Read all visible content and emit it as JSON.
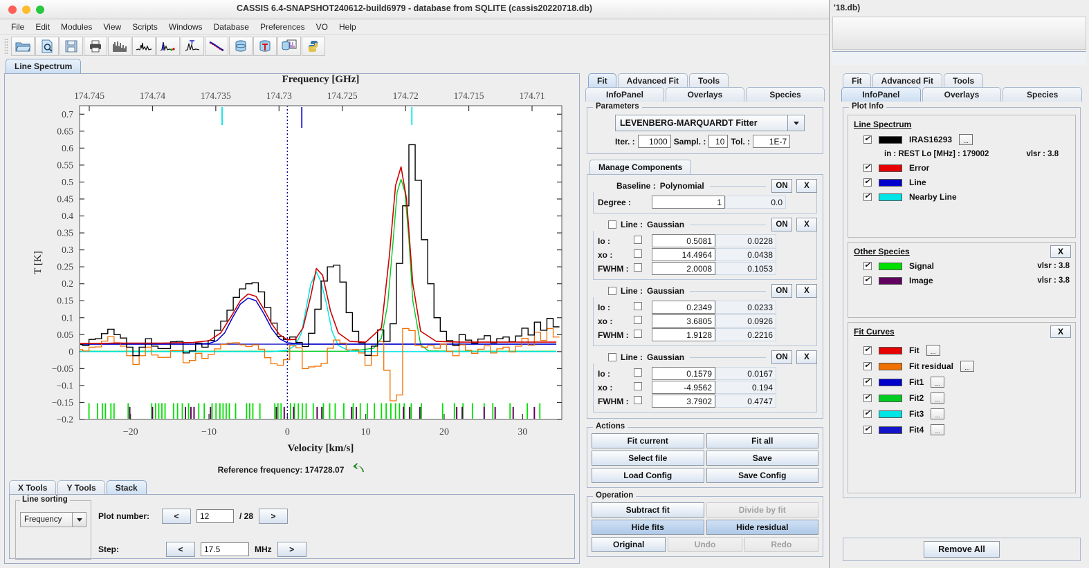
{
  "window": {
    "title": "CASSIS 6.4-SNAPSHOT240612-build6979 - database from SQLITE (cassis20220718.db)",
    "background_window_title": "'18.db)"
  },
  "menu": {
    "items": [
      "File",
      "Edit",
      "Modules",
      "View",
      "Scripts",
      "Windows",
      "Database",
      "Preferences",
      "VO",
      "Help"
    ]
  },
  "toolbar": {
    "icons": [
      "open-folder-icon",
      "document-search-icon",
      "save-disk-icon",
      "print-icon",
      "line-list-icon",
      "spectrum-noise-icon",
      "spectrum-markers-icon",
      "spectrum-tag-icon",
      "continuum-fit-icon",
      "database-icon",
      "database-temperature-icon",
      "database-spectrum-icon",
      "python-script-icon"
    ]
  },
  "main_tabs": {
    "items": [
      "Line Spectrum"
    ],
    "selected": "Line Spectrum"
  },
  "chart_data": {
    "type": "line",
    "title": "",
    "xlabel": "Velocity [km/s]",
    "ylabel": "T [K]",
    "top_axis_label": "Frequency [GHz]",
    "top_axis_ticks": [
      "174.745",
      "174.74",
      "174.735",
      "174.73",
      "174.725",
      "174.72",
      "174.715",
      "174.71"
    ],
    "top_axis_values": [
      174.745,
      174.74,
      174.735,
      174.73,
      174.725,
      174.72,
      174.715,
      174.71
    ],
    "xticks": [
      -20,
      -10,
      0,
      10,
      20,
      30
    ],
    "xlim": [
      -26.5,
      35.0
    ],
    "yticks": [
      0.7,
      0.65,
      0.6,
      0.55,
      0.5,
      0.45,
      0.4,
      0.35,
      0.3,
      0.25,
      0.2,
      0.15,
      0.1,
      0.05,
      0,
      -0.05,
      -0.1,
      -0.15,
      -0.2
    ],
    "ylim": [
      -0.2,
      0.725
    ],
    "grid": false,
    "reference_frequency_label": "Reference frequency: 174728.07",
    "series": [
      {
        "name": "IRAS16293",
        "color": "#000000",
        "comment": "observed spectrum, histogram step",
        "x": [
          -26.5,
          -25.7,
          -24.9,
          -24.1,
          -23.3,
          -22.5,
          -21.7,
          -20.9,
          -20.1,
          -19.3,
          -18.5,
          -17.7,
          -16.9,
          -16.1,
          -15.3,
          -14.5,
          -13.7,
          -12.9,
          -12.1,
          -11.3,
          -10.5,
          -9.7,
          -8.9,
          -8.1,
          -7.3,
          -6.5,
          -5.7,
          -4.9,
          -4.1,
          -3.3,
          -2.5,
          -1.7,
          -0.9,
          -0.1,
          0.7,
          1.5,
          2.3,
          3.1,
          3.9,
          4.7,
          5.5,
          6.3,
          7.1,
          7.9,
          8.7,
          9.5,
          10.3,
          11.1,
          11.9,
          12.7,
          13.5,
          14.3,
          15.1,
          15.9,
          16.7,
          17.5,
          18.3,
          19.1,
          19.9,
          20.7,
          21.5,
          22.3,
          23.1,
          23.9,
          24.7,
          25.5,
          26.3,
          27.1,
          27.9,
          28.7,
          29.5,
          30.3,
          31.1,
          31.9,
          32.7,
          33.5,
          34.3
        ],
        "y": [
          0.021,
          0.018,
          0.036,
          0.038,
          0.053,
          0.066,
          0.05,
          0.04,
          0.013,
          -0.012,
          0.013,
          0.038,
          0.016,
          0.009,
          0.009,
          0.029,
          0.03,
          -0.004,
          0.002,
          0.025,
          0.013,
          0.033,
          0.063,
          0.09,
          0.122,
          0.16,
          0.185,
          0.2,
          0.203,
          0.176,
          0.13,
          0.084,
          0.045,
          0.036,
          0.043,
          0.027,
          0.015,
          0.054,
          0.125,
          0.208,
          0.25,
          0.255,
          0.205,
          0.115,
          0.06,
          0.026,
          -0.011,
          0.016,
          0.064,
          0.03,
          0.082,
          0.26,
          0.43,
          0.61,
          0.505,
          0.33,
          0.2,
          0.1,
          0.06,
          0.032,
          0.018,
          0.05,
          0.034,
          0.025,
          0.037,
          0.047,
          0.026,
          0.038,
          0.043,
          0.029,
          0.046,
          0.069,
          0.049,
          0.087,
          0.063,
          0.098,
          0.073
        ]
      },
      {
        "name": "Fit",
        "color": "#d00000",
        "comment": "total fit curve (red)",
        "x": [
          -26.5,
          -24,
          -22,
          -20,
          -18,
          -16,
          -14,
          -12,
          -10,
          -8.5,
          -7,
          -6,
          -5,
          -4,
          -3,
          -2,
          -1,
          0,
          1,
          2,
          3,
          3.7,
          4.5,
          5.5,
          6.5,
          8,
          10,
          12,
          13,
          13.8,
          14.5,
          15.2,
          16,
          17,
          19,
          22,
          26,
          30,
          34.3
        ],
        "y": [
          0.024,
          0.024,
          0.025,
          0.025,
          0.025,
          0.025,
          0.026,
          0.027,
          0.032,
          0.055,
          0.11,
          0.15,
          0.17,
          0.163,
          0.125,
          0.082,
          0.05,
          0.035,
          0.036,
          0.07,
          0.165,
          0.245,
          0.225,
          0.12,
          0.055,
          0.03,
          0.028,
          0.07,
          0.28,
          0.49,
          0.545,
          0.45,
          0.2,
          0.06,
          0.03,
          0.028,
          0.028,
          0.028,
          0.028
        ]
      },
      {
        "name": "Fit residual",
        "color": "#f07000",
        "comment": "residual (orange, noisy around zero)",
        "x": [
          -26.5,
          -25.7,
          -24.9,
          -24.1,
          -23.3,
          -22.5,
          -21.7,
          -20.9,
          -20.1,
          -19.3,
          -18.5,
          -17.7,
          -16.9,
          -16.1,
          -15.3,
          -14.5,
          -13.7,
          -12.9,
          -12.1,
          -11.3,
          -10.5,
          -9.7,
          -8.9,
          -8.1,
          -7.3,
          -6.5,
          -5.7,
          -4.9,
          -4.1,
          -3.3,
          -2.5,
          -1.7,
          -0.9,
          -0.1,
          0.7,
          1.5,
          2.3,
          3.1,
          3.9,
          4.7,
          5.5,
          6.3,
          7.1,
          7.9,
          8.7,
          9.5,
          10.3,
          11.1,
          11.9,
          12.7,
          13.5,
          14.3,
          15.1,
          15.9,
          16.7,
          17.5,
          18.3,
          19.1,
          19.9,
          20.7,
          21.5,
          22.3,
          23.1,
          23.9,
          24.7,
          25.5,
          26.3,
          27.1,
          27.9,
          28.7,
          29.5,
          30.3,
          31.1,
          31.9,
          32.7,
          33.5,
          34.3
        ],
        "y": [
          0.006,
          0.002,
          0.013,
          0.014,
          0.031,
          0.044,
          0.026,
          0.016,
          -0.012,
          -0.038,
          -0.012,
          0.013,
          -0.01,
          -0.017,
          -0.017,
          0.003,
          0.003,
          -0.033,
          -0.026,
          -0.005,
          -0.02,
          -0.008,
          0.008,
          0.021,
          0.025,
          0.026,
          0.02,
          0.015,
          0.02,
          0.007,
          -0.018,
          -0.036,
          -0.04,
          -0.024,
          0.018,
          0.011,
          -0.05,
          -0.045,
          -0.043,
          -0.035,
          0.01,
          0.034,
          0.025,
          0.005,
          0.006,
          -0.004,
          -0.04,
          -0.012,
          0.03,
          -0.055,
          -0.145,
          -0.128,
          0.068,
          0.062,
          0.018,
          0.013,
          0.018,
          0.01,
          0.022,
          0.001,
          -0.012,
          0.02,
          0.004,
          -0.005,
          0.007,
          0.017,
          -0.004,
          0.008,
          0.013,
          -0.001,
          0.016,
          0.039,
          0.019,
          0.057,
          0.033,
          0.068,
          0.043
        ]
      },
      {
        "name": "Fit1",
        "color": "#0000cd",
        "comment": "Gaussian component 1 (blue) centered near -4.96",
        "x": [
          -26.5,
          -16,
          -12,
          -10,
          -9,
          -8,
          -7,
          -6,
          -5,
          -4,
          -3,
          -2,
          -1,
          0,
          2,
          6,
          12,
          20,
          30,
          34.3
        ],
        "y": [
          0.022,
          0.022,
          0.022,
          0.024,
          0.032,
          0.055,
          0.1,
          0.14,
          0.158,
          0.15,
          0.112,
          0.068,
          0.038,
          0.026,
          0.022,
          0.022,
          0.022,
          0.022,
          0.022,
          0.022
        ]
      },
      {
        "name": "Fit2",
        "color": "#00cc22",
        "comment": "Gaussian component 2 (green) near 14.5",
        "x": [
          -26.5,
          0,
          8,
          11,
          12,
          12.8,
          13.5,
          14,
          14.5,
          15,
          15.5,
          16,
          17,
          18,
          22,
          30,
          34.3
        ],
        "y": [
          0.001,
          0.001,
          0.001,
          0.01,
          0.04,
          0.14,
          0.33,
          0.47,
          0.508,
          0.47,
          0.33,
          0.15,
          0.02,
          0.002,
          0.001,
          0.001,
          0.001
        ]
      },
      {
        "name": "Fit3",
        "color": "#00e5e5",
        "comment": "Gaussian component 3 (cyan) near 3.68",
        "x": [
          -26.5,
          -2,
          0,
          1,
          1.8,
          2.5,
          3.0,
          3.7,
          4.3,
          5,
          5.7,
          6.5,
          8,
          12,
          20,
          34.3
        ],
        "y": [
          0.0,
          0.0,
          0.004,
          0.018,
          0.055,
          0.14,
          0.2,
          0.235,
          0.205,
          0.14,
          0.06,
          0.018,
          0.001,
          0.0,
          0.0,
          0.0
        ]
      },
      {
        "name": "Fit4",
        "color": "#1414c8",
        "comment": "baseline polynomial degree 1 (blue flat)",
        "x": [
          -26.5,
          34.3
        ],
        "y": [
          0.022,
          0.022
        ]
      },
      {
        "name": "Signal",
        "color": "#00cc22",
        "comment": "signal species marker ticks at y=-0.15..-0.2",
        "velocities": [
          -25.3,
          -24.2,
          -23.6,
          -23.2,
          -22.5,
          -22.1,
          -20.3,
          -17.3,
          -16.8,
          -16.4,
          -16.0,
          -15.6,
          -14.5,
          -14.0,
          -13.4,
          -12.6,
          -11.3,
          -10.6,
          -9.6,
          -9.1,
          -8.6,
          -8.2,
          -7.8,
          -7.4,
          -6.6,
          -5.2,
          -4.8,
          -4.4,
          -3.5,
          -1.6,
          -1.2,
          -0.8,
          0.4,
          0.9,
          1.4,
          1.9,
          2.4,
          3.3,
          4.6,
          5.4,
          6.1,
          7.2,
          8.4,
          9.3,
          10.2,
          11.1,
          12.0,
          12.6,
          13.2,
          13.8,
          14.3,
          14.9,
          15.8,
          17.1,
          19.8,
          21.3,
          22.4,
          23.6,
          25.1,
          26.2,
          28.4,
          30.6,
          32.2
        ]
      },
      {
        "name": "Image",
        "color": "#60005f",
        "comment": "image species marker ticks (dark purple)",
        "velocities": [
          -20.1,
          -17.2,
          -13.0,
          -12.3,
          -11.9,
          -9.8,
          -1.4,
          -0.4,
          0.8,
          3.8,
          4.4,
          8.2,
          8.8,
          14.8,
          15.6,
          16.9,
          21.6,
          22.3,
          25.1,
          26.5,
          28.8,
          31.5
        ]
      },
      {
        "name": "Nearby Line",
        "color": "#00e5e5",
        "comment": "nearby line markers at top of plot",
        "frequencies": [
          174.7345,
          174.7195
        ]
      },
      {
        "name": "Line",
        "color": "#0000cd",
        "comment": "line marker at top of plot",
        "frequencies": [
          174.7282
        ]
      }
    ],
    "vertical_reference": {
      "velocity": 0,
      "color": "#00008b",
      "style": "dotted"
    }
  },
  "bottom_tabs": {
    "items": [
      "X Tools",
      "Y Tools",
      "Stack"
    ],
    "selected": "Stack"
  },
  "stack": {
    "line_sorting_label": "Line sorting",
    "sort_by": "Frequency",
    "plot_number_label": "Plot number:",
    "plot_number": "12",
    "plot_total": "/ 28",
    "step_label": "Step:",
    "step_value": "17.5",
    "step_unit": "MHz",
    "prev_label": "<",
    "next_label": ">"
  },
  "fit_panel": {
    "tabs_row1": [
      "Fit",
      "Advanced Fit",
      "Tools"
    ],
    "tabs_row1_selected": "Fit",
    "tabs_row2": [
      "InfoPanel",
      "Overlays",
      "Species"
    ],
    "tabs_row2_selected": "",
    "parameters": {
      "group_label": "Parameters",
      "fitter": "LEVENBERG-MARQUARDT Fitter",
      "iter_label": "Iter. :",
      "iter_value": "1000",
      "sampl_label": "Sampl. :",
      "sampl_value": "10",
      "tol_label": "Tol. :",
      "tol_value": "1E-7"
    },
    "manage_components_label": "Manage Components",
    "baseline": {
      "label": "Baseline :",
      "type": "Polynomial",
      "on_label": "ON",
      "x_label": "X",
      "degree_label": "Degree :",
      "degree_value": "1",
      "degree_err": "0.0"
    },
    "components": [
      {
        "label": "Line :",
        "type": "Gaussian",
        "on_label": "ON",
        "x_label": "X",
        "rows": [
          {
            "name": "Io :",
            "value": "0.5081",
            "error": "0.0228"
          },
          {
            "name": "xo :",
            "value": "14.4964",
            "error": "0.0438"
          },
          {
            "name": "FWHM :",
            "value": "2.0008",
            "error": "0.1053"
          }
        ]
      },
      {
        "label": "Line :",
        "type": "Gaussian",
        "on_label": "ON",
        "x_label": "X",
        "rows": [
          {
            "name": "Io :",
            "value": "0.2349",
            "error": "0.0233"
          },
          {
            "name": "xo :",
            "value": "3.6805",
            "error": "0.0926"
          },
          {
            "name": "FWHM :",
            "value": "1.9128",
            "error": "0.2216"
          }
        ]
      },
      {
        "label": "Line :",
        "type": "Gaussian",
        "on_label": "ON",
        "x_label": "X",
        "rows": [
          {
            "name": "Io :",
            "value": "0.1579",
            "error": "0.0167"
          },
          {
            "name": "xo :",
            "value": "-4.9562",
            "error": "0.194"
          },
          {
            "name": "FWHM :",
            "value": "3.7902",
            "error": "0.4747"
          }
        ]
      }
    ],
    "actions": {
      "group_label": "Actions",
      "buttons": [
        "Fit current",
        "Fit all",
        "Select file",
        "Save",
        "Load Config",
        "Save Config"
      ]
    },
    "operation": {
      "group_label": "Operation",
      "subtract_fit": "Subtract fit",
      "divide_by_fit": "Divide by fit",
      "hide_fits": "Hide fits",
      "hide_residual": "Hide residual",
      "original": "Original",
      "undo": "Undo",
      "redo": "Redo"
    }
  },
  "info_panel": {
    "tabs_row1": [
      "Fit",
      "Advanced Fit",
      "Tools"
    ],
    "tabs_row2": [
      "InfoPanel",
      "Overlays",
      "Species"
    ],
    "tabs_row2_selected": "InfoPanel",
    "plot_info_label": "Plot Info",
    "line_spectrum_header": "Line Spectrum",
    "spectrum_entries": [
      {
        "label": "IRAS16293",
        "color": "#000000",
        "has_dots": true,
        "checked": true
      },
      {
        "label": "Error",
        "color": "#e60000",
        "has_dots": false,
        "checked": true
      },
      {
        "label": "Line",
        "color": "#0000cd",
        "has_dots": false,
        "checked": true
      },
      {
        "label": "Nearby Line",
        "color": "#00e5e5",
        "has_dots": false,
        "checked": true
      }
    ],
    "spectrum_detail": {
      "left": "in : REST Lo [MHz] : 179002",
      "right": "vlsr : 3.8"
    },
    "other_species": {
      "header": "Other Species",
      "x_label": "X",
      "entries": [
        {
          "label": "Signal",
          "color": "#00e000",
          "vlsr": "vlsr : 3.8",
          "checked": true
        },
        {
          "label": "Image",
          "color": "#60005f",
          "vlsr": "vlsr : 3.8",
          "checked": true
        }
      ]
    },
    "fit_curves": {
      "header": "Fit Curves",
      "x_label": "X",
      "entries": [
        {
          "label": "Fit",
          "color": "#e60000",
          "checked": true
        },
        {
          "label": "Fit residual",
          "color": "#f07000",
          "checked": true
        },
        {
          "label": "Fit1",
          "color": "#0000cd",
          "checked": true
        },
        {
          "label": "Fit2",
          "color": "#00cc22",
          "checked": true
        },
        {
          "label": "Fit3",
          "color": "#00e5e5",
          "checked": true
        },
        {
          "label": "Fit4",
          "color": "#1414c8",
          "checked": true
        }
      ]
    },
    "remove_all_label": "Remove All"
  }
}
